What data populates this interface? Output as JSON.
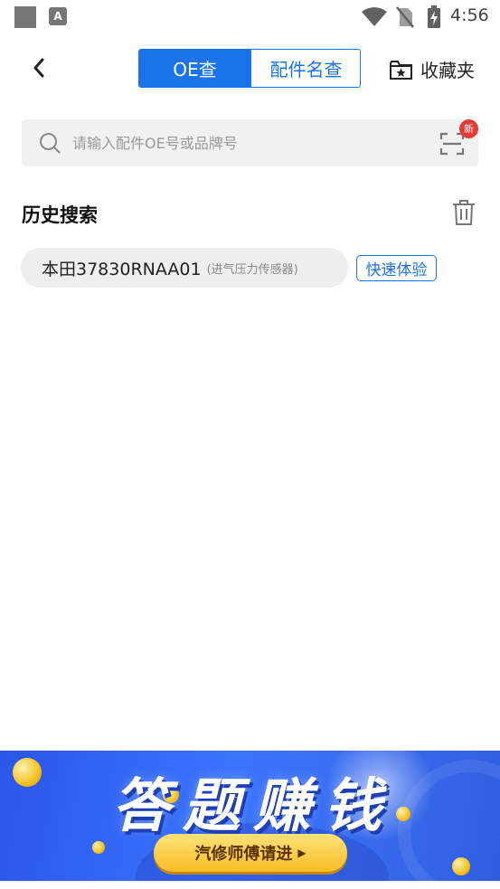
{
  "status_bar": {
    "time": "4:56",
    "icons": [
      "app-square-icon",
      "a-notification-icon",
      "wifi-icon",
      "no-sim-icon",
      "battery-charging-icon"
    ]
  },
  "header": {
    "back_icon": "chevron-left-icon",
    "tabs": [
      {
        "label": "OE查",
        "active": true
      },
      {
        "label": "配件名查",
        "active": false
      }
    ],
    "favorites_icon": "star-folder-icon",
    "favorites_label": "收藏夹"
  },
  "search": {
    "placeholder": "请输入配件OE号或品牌号",
    "value": "",
    "scan_icon": "scan-icon",
    "new_badge": "新"
  },
  "history": {
    "title": "历史搜索",
    "delete_icon": "trash-icon",
    "items": [
      {
        "main": "本田37830RNAA01",
        "sub": "(进气压力传感器)"
      }
    ],
    "quick_button": "快速体验"
  },
  "banner": {
    "title": "答题赚钱",
    "button_label": "汽修师傅请进",
    "button_arrow": "▶"
  },
  "colors": {
    "accent": "#1a73e8",
    "badge": "#e53935",
    "banner_blue": "#3a74ff",
    "banner_button": "#f7bd24"
  }
}
